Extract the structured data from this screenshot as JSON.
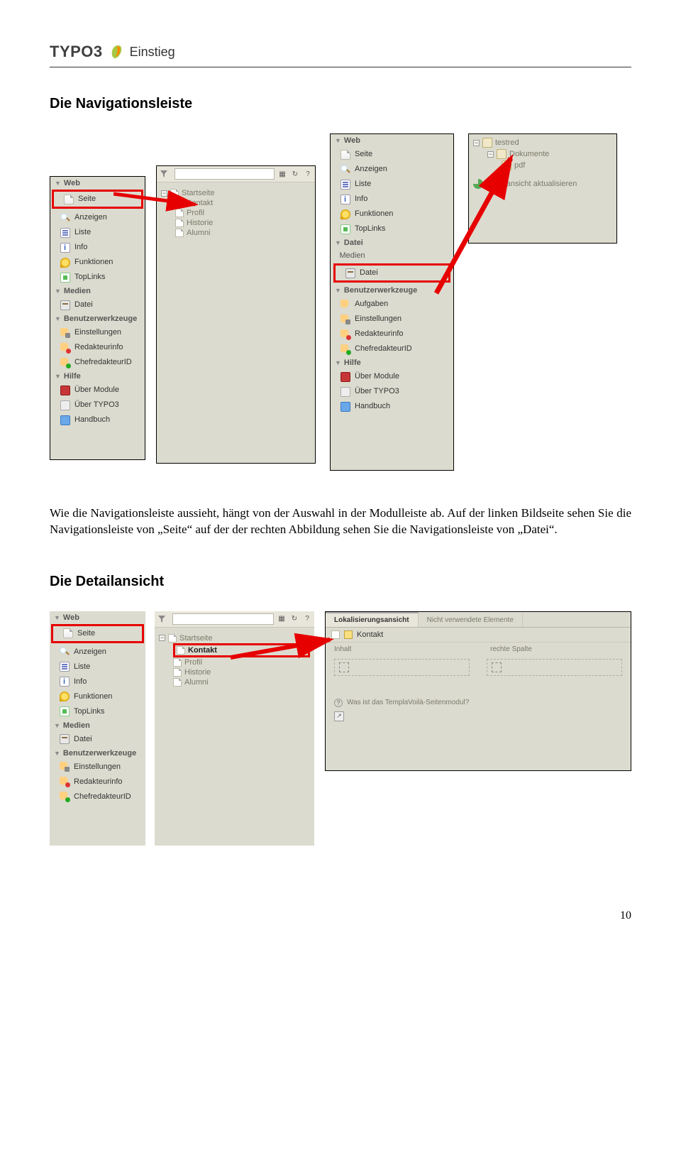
{
  "header": {
    "logo_text": "TYPO3",
    "chapter": "Einstieg"
  },
  "sections": {
    "nav_title": "Die Navigationsleiste",
    "detail_title": "Die Detailansicht"
  },
  "paragraph": "Wie die Navigationsleiste aussieht, hängt von der Auswahl in der Modulleiste ab. Auf der linken Bildseite sehen Sie die Navigationsleiste von „Seite“ auf der der rechten Abbildung sehen Sie die Navigationsleiste von „Datei“.",
  "modules": {
    "web": "Web",
    "web_items": [
      "Seite",
      "Anzeigen",
      "Liste",
      "Info",
      "Funktionen",
      "TopLinks"
    ],
    "medien": "Medien",
    "datei_group": "Datei",
    "datei": "Datei",
    "benutzer": "Benutzerwerkzeuge",
    "benutzer_items_left": [
      "Einstellungen",
      "Redakteurinfo",
      "ChefredakteurID"
    ],
    "benutzer_items_mid": [
      "Aufgaben",
      "Einstellungen",
      "Redakteurinfo",
      "ChefredakteurID"
    ],
    "hilfe": "Hilfe",
    "hilfe_items": [
      "Über Module",
      "Über TYPO3",
      "Handbuch"
    ]
  },
  "tree_seite": {
    "root": "Startseite",
    "children": [
      "Kontakt",
      "Profil",
      "Historie",
      "Alumni"
    ]
  },
  "tree_datei": {
    "root": "testred",
    "child1": "Dokumente",
    "child2": "pdf",
    "refresh": "Baumansicht aktualisieren"
  },
  "detail": {
    "tab_local": "Lokalisierungsansicht",
    "tab_unused": "Nicht verwendete Elemente",
    "page_name": "Kontakt",
    "col_left": "Inhalt",
    "col_right": "rechte Spalte",
    "help": "Was ist das TemplaVoilà-Seitenmodul?"
  },
  "page_number": "10"
}
